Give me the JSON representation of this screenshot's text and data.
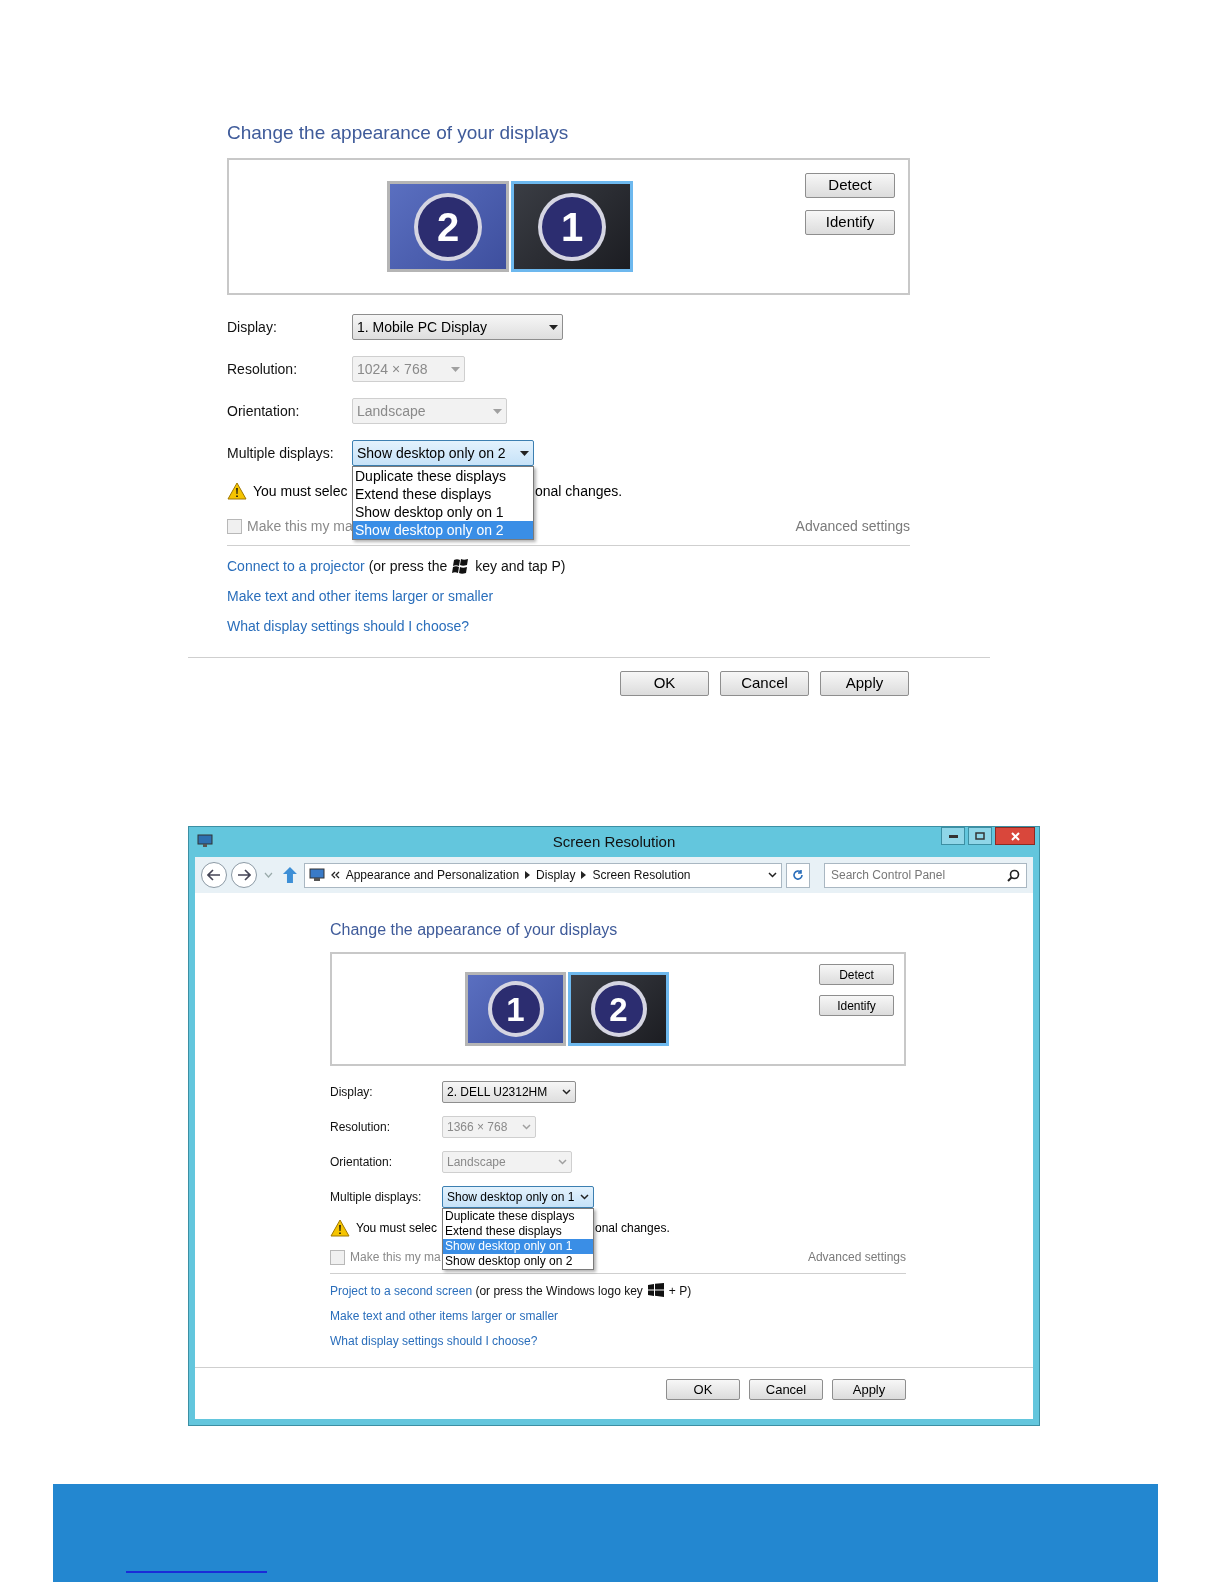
{
  "panels": [
    {
      "kind": "plain",
      "heading": "Change the appearance of your displays",
      "monitors": [
        {
          "label": "2",
          "kind": "desktop",
          "selected": false
        },
        {
          "label": "1",
          "kind": "dark",
          "selected": true
        }
      ],
      "side_buttons": [
        "Detect",
        "Identify"
      ],
      "fields": [
        {
          "label": "Display:",
          "value": "1. Mobile PC Display",
          "disabled": false
        },
        {
          "label": "Resolution:",
          "value": "1024 × 768",
          "disabled": true
        },
        {
          "label": "Orientation:",
          "value": "Landscape",
          "disabled": true
        },
        {
          "label": "Multiple displays:",
          "value": "Show desktop only on 2",
          "disabled": false,
          "expanded": true,
          "options": [
            {
              "label": "Duplicate these displays",
              "selected": false
            },
            {
              "label": "Extend these displays",
              "selected": false
            },
            {
              "label": "Show desktop only on 1",
              "selected": false
            },
            {
              "label": "Show desktop only on 2",
              "selected": true
            }
          ]
        }
      ],
      "warning": {
        "before": "You must selec",
        "after": "onal changes."
      },
      "checkbox": {
        "label": "Make this my ma",
        "checked": false,
        "disabled": true
      },
      "advanced_settings": {
        "label": "Advanced settings",
        "disabled": true
      },
      "links": [
        {
          "kind": "shortcut",
          "link": "Connect to a projector",
          "before_icon": "(or press the",
          "after_icon": "key and tap P)"
        },
        {
          "kind": "plain",
          "link": "Make text and other items larger or smaller"
        },
        {
          "kind": "plain",
          "link": "What display settings should I choose?"
        }
      ],
      "footer_buttons": [
        "OK",
        "Cancel",
        "Apply"
      ]
    },
    {
      "kind": "window",
      "window": {
        "title": "Screen Resolution"
      },
      "address": {
        "crumbs": [
          "Appearance and Personalization",
          "Display",
          "Screen Resolution"
        ]
      },
      "search": {
        "placeholder": "Search Control Panel"
      },
      "heading": "Change the appearance of your displays",
      "monitors": [
        {
          "label": "1",
          "kind": "desktop",
          "selected": false
        },
        {
          "label": "2",
          "kind": "dark",
          "selected": true
        }
      ],
      "side_buttons": [
        "Detect",
        "Identify"
      ],
      "fields": [
        {
          "label": "Display:",
          "value": "2. DELL U2312HM",
          "disabled": false
        },
        {
          "label": "Resolution:",
          "value": "1366 × 768",
          "disabled": true
        },
        {
          "label": "Orientation:",
          "value": "Landscape",
          "disabled": true
        },
        {
          "label": "Multiple displays:",
          "value": "Show desktop only on 1",
          "disabled": false,
          "expanded": true,
          "options": [
            {
              "label": "Duplicate these displays",
              "selected": false
            },
            {
              "label": "Extend these displays",
              "selected": false
            },
            {
              "label": "Show desktop only on 1",
              "selected": true
            },
            {
              "label": "Show desktop only on 2",
              "selected": false
            }
          ]
        }
      ],
      "warning": {
        "before": "You must selec",
        "after": "onal changes."
      },
      "checkbox": {
        "label": "Make this my ma",
        "checked": false,
        "disabled": true
      },
      "advanced_settings": {
        "label": "Advanced settings",
        "disabled": true
      },
      "links": [
        {
          "kind": "shortcut",
          "link": "Project to a second screen",
          "before_icon": "(or press the Windows logo key",
          "after_icon": "+ P)"
        },
        {
          "kind": "plain",
          "link": "Make text and other items larger or smaller"
        },
        {
          "kind": "plain",
          "link": "What display settings should I choose?"
        }
      ],
      "footer_buttons": [
        "OK",
        "Cancel",
        "Apply"
      ]
    }
  ]
}
